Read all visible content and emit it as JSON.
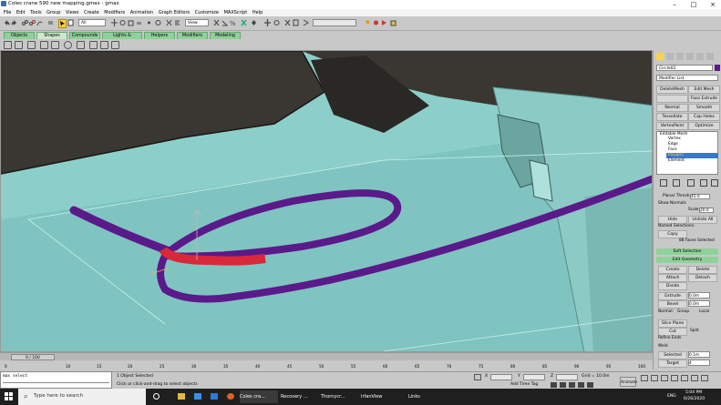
{
  "window": {
    "title": "Coles crane 590 new mapping.gmax - gmax",
    "controls": [
      "–",
      "□",
      "×"
    ]
  },
  "menu": [
    "File",
    "Edit",
    "Tools",
    "Group",
    "Views",
    "Create",
    "Modifiers",
    "Animation",
    "Graph Editors",
    "Customize",
    "MAXScript",
    "Help"
  ],
  "toolbar": {
    "selection_filter": "All",
    "view_dropdown": "View"
  },
  "tabs": [
    "Objects",
    "Shapes",
    "Compounds",
    "Lights & Cameras",
    "Helpers",
    "Modifiers",
    "Modeling"
  ],
  "command_panel": {
    "object_name": "Circle02",
    "modifier_list": "Modifier List",
    "modifier_buttons": [
      "DeleteMesh",
      "Edit Mesh",
      "",
      "Face Extrude",
      "Normal",
      "Smooth",
      "Tessellate",
      "Cap Holes",
      "VertexPaint",
      "Optimize"
    ],
    "stack": [
      "Editable Mesh",
      "Vertex",
      "Edge",
      "Face",
      "Polygon",
      "Element"
    ],
    "selected_stack_item": "Polygon",
    "planar_thresh_label": "Planar Thresh",
    "planar_thresh_value": "45.0",
    "show_normals": "Show Normals",
    "scale_label": "Scale",
    "scale_value": "20.0",
    "hide": "Hide",
    "unhide_all": "Unhide All",
    "named_selections": "Named Selections:",
    "copy": "Copy",
    "faces_selected": "88 Faces Selected",
    "soft_selection": "Soft Selection",
    "edit_geometry": "Edit Geometry",
    "create": "Create",
    "delete": "Delete",
    "attach": "Attach",
    "detach": "Detach",
    "divide": "Divide",
    "extrude": "Extrude",
    "extrude_value": "0.0m",
    "bevel": "Bevel",
    "bevel_value": "0.0m",
    "normal": "Normal:",
    "group": "Group",
    "local": "Local",
    "slice_plane": "Slice Plane",
    "cut": "Cut",
    "split": "Split",
    "refine_ends": "Refine Ends",
    "weld": "Weld",
    "selected": "Selected",
    "selected_value": "0.1m",
    "target": "Target",
    "target_value": "4"
  },
  "timeline": {
    "frame": "0 / 100",
    "ticks": [
      "0",
      "10",
      "15",
      "20",
      "25",
      "30",
      "35",
      "40",
      "45",
      "50",
      "55",
      "60",
      "65",
      "70",
      "75",
      "80",
      "85",
      "90",
      "95",
      "100"
    ]
  },
  "statusbar": {
    "maxscript_text": "max select",
    "objects_selected": "1 Object Selected",
    "prompt": "Click or click-and-drag to select objects",
    "x_label": "X",
    "y_label": "Y",
    "z_label": "Z",
    "grid": "Grid = 10.0m",
    "add_time_tag": "Add Time Tag",
    "animate": "Animate"
  },
  "taskbar": {
    "search_placeholder": "Type here to search",
    "apps": [
      "Coles cra...",
      "Recovery ...",
      "Thornycr...",
      "IrfanView"
    ],
    "links": "Links",
    "lang": "ENG",
    "time": "5:04 PM",
    "date": "6/26/2020"
  },
  "colors": {
    "viewport_floor": "#7fc4c0",
    "tube": "#5a1a8a",
    "selected_faces": "#d8283a",
    "tab_green": "#8fd19a"
  }
}
